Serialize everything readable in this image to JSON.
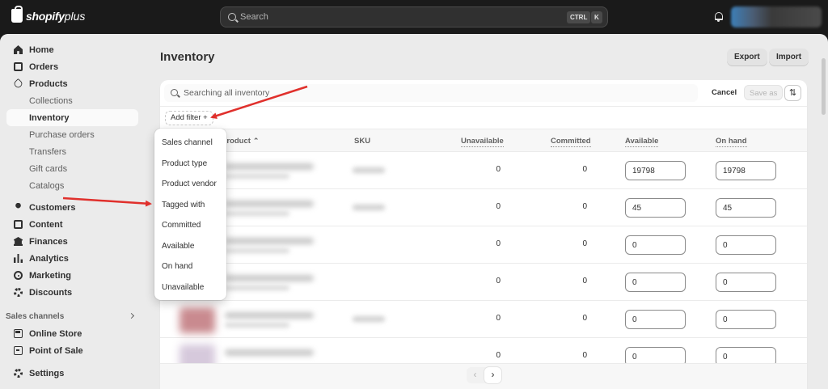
{
  "topbar": {
    "logo_text": "shopify",
    "logo_plus": "plus",
    "search_placeholder": "Search",
    "kbd_ctrl": "CTRL",
    "kbd_k": "K"
  },
  "sidebar": {
    "items": [
      {
        "label": "Home",
        "icon": "home-icon"
      },
      {
        "label": "Orders",
        "icon": "orders-icon"
      },
      {
        "label": "Products",
        "icon": "tag-icon"
      },
      {
        "label": "Collections"
      },
      {
        "label": "Inventory"
      },
      {
        "label": "Purchase orders"
      },
      {
        "label": "Transfers"
      },
      {
        "label": "Gift cards"
      },
      {
        "label": "Catalogs"
      },
      {
        "label": "Customers",
        "icon": "person-icon"
      },
      {
        "label": "Content",
        "icon": "content-icon"
      },
      {
        "label": "Finances",
        "icon": "bank-icon"
      },
      {
        "label": "Analytics",
        "icon": "bar-chart-icon"
      },
      {
        "label": "Marketing",
        "icon": "target-icon"
      },
      {
        "label": "Discounts",
        "icon": "discount-icon"
      }
    ],
    "sales_channels_heading": "Sales channels",
    "channels": [
      {
        "label": "Online Store",
        "icon": "store-icon"
      },
      {
        "label": "Point of Sale",
        "icon": "pos-icon"
      }
    ],
    "settings_label": "Settings"
  },
  "main": {
    "title": "Inventory",
    "export_label": "Export",
    "import_label": "Import",
    "search_placeholder": "Searching all inventory",
    "cancel_label": "Cancel",
    "save_as_label": "Save as",
    "add_filter_label": "Add filter",
    "add_filter_glyph": "+",
    "sort_glyph": "⇅",
    "columns": {
      "product": "Product",
      "sku": "SKU",
      "unavailable": "Unavailable",
      "committed": "Committed",
      "available": "Available",
      "on_hand": "On hand"
    },
    "rows": [
      {
        "unavailable": "0",
        "committed": "0",
        "available": "19798",
        "on_hand": "19798"
      },
      {
        "unavailable": "0",
        "committed": "0",
        "available": "45",
        "on_hand": "45"
      },
      {
        "unavailable": "0",
        "committed": "0",
        "available": "0",
        "on_hand": "0"
      },
      {
        "unavailable": "0",
        "committed": "0",
        "available": "0",
        "on_hand": "0"
      },
      {
        "unavailable": "0",
        "committed": "0",
        "available": "0",
        "on_hand": "0"
      },
      {
        "unavailable": "0",
        "committed": "0",
        "available": "0",
        "on_hand": "0"
      }
    ],
    "pager_prev": "‹",
    "pager_next": "›"
  },
  "filter_dropdown": {
    "options": [
      "Sales channel",
      "Product type",
      "Product vendor",
      "Tagged with",
      "Committed",
      "Available",
      "On hand",
      "Unavailable"
    ]
  },
  "colors": {
    "topbar_bg": "#1a1a1a",
    "frame_bg": "#ebebeb",
    "annotation_arrow": "#e0302c"
  }
}
